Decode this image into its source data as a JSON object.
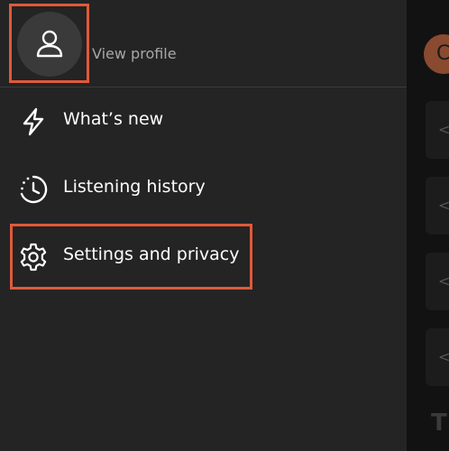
{
  "background": {
    "avatar_initial": "C",
    "heading_fragment": "T",
    "card_glyph": "<"
  },
  "drawer": {
    "profile": {
      "name_fragment": "· · · · · ·",
      "view_profile_label": "View profile",
      "avatar_icon": "person-icon"
    },
    "menu": [
      {
        "label": "What’s new",
        "icon": "lightning-icon"
      },
      {
        "label": "Listening history",
        "icon": "history-icon"
      },
      {
        "label": "Settings and privacy",
        "icon": "gear-icon"
      }
    ]
  },
  "colors": {
    "drawer_bg": "#242424",
    "highlight": "#e05a3a",
    "text": "#ffffff",
    "muted_text": "#a7a7a7"
  }
}
